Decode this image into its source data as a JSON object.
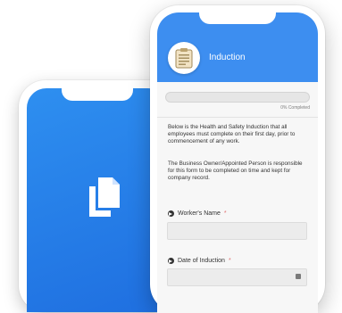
{
  "app": {
    "title": "Induction",
    "progress_percent": 0,
    "progress_label": "0% Completed",
    "intro_paragraphs": [
      "Below is the Health and Safety Induction that all employees must complete on their first day, prior to commencement of any work.",
      "The Business Owner/Appointed Person is responsible for this form to be completed on time and kept for company record."
    ]
  },
  "fields": [
    {
      "label": "Worker's Name",
      "required_mark": "*",
      "value": ""
    },
    {
      "label": "Date of Induction",
      "required_mark": "*",
      "value": ""
    }
  ],
  "icons": {
    "back_phone": "documents-icon",
    "header": "clipboard-icon",
    "field_marker": "arrow-circle-icon",
    "date_picker": "calendar-icon"
  },
  "colors": {
    "brand_blue": "#3d8ef0",
    "back_screen_blue": "#2e8ff0",
    "required": "#e07070"
  }
}
